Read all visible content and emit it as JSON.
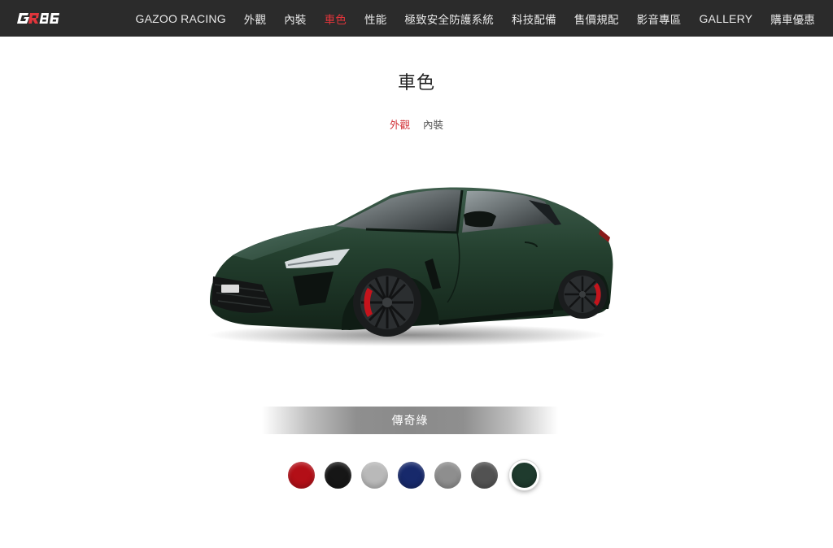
{
  "brand": {
    "logo_text": "GR86"
  },
  "nav": {
    "items": [
      {
        "label": "GAZOO RACING",
        "active": false
      },
      {
        "label": "外觀",
        "active": false
      },
      {
        "label": "內裝",
        "active": false
      },
      {
        "label": "車色",
        "active": true
      },
      {
        "label": "性能",
        "active": false
      },
      {
        "label": "極致安全防護系統",
        "active": false
      },
      {
        "label": "科技配備",
        "active": false
      },
      {
        "label": "售價規配",
        "active": false
      },
      {
        "label": "影音專區",
        "active": false
      },
      {
        "label": "GALLERY",
        "active": false
      },
      {
        "label": "購車優惠",
        "active": false
      }
    ],
    "active_color": "#e0353b"
  },
  "page": {
    "title": "車色",
    "sub_tabs": [
      {
        "label": "外觀",
        "active": true
      },
      {
        "label": "內裝",
        "active": false
      }
    ]
  },
  "car": {
    "image": "green-gr86-coupe",
    "body_color": "#1f3a2c"
  },
  "selected_color": {
    "name": "傳奇綠"
  },
  "swatches": [
    {
      "icon": "red-swatch",
      "color": "#b30f17",
      "selected": false
    },
    {
      "icon": "black-swatch",
      "color": "#161616",
      "selected": false
    },
    {
      "icon": "silver-swatch",
      "color": "#b9b9b9",
      "selected": false
    },
    {
      "icon": "blue-swatch",
      "color": "#17296b",
      "selected": false
    },
    {
      "icon": "gray-swatch",
      "color": "#8e8e8e",
      "selected": false
    },
    {
      "icon": "dark-gray-swatch",
      "color": "#525252",
      "selected": false
    },
    {
      "icon": "green-swatch",
      "color": "#1f3b2e",
      "selected": true
    }
  ]
}
